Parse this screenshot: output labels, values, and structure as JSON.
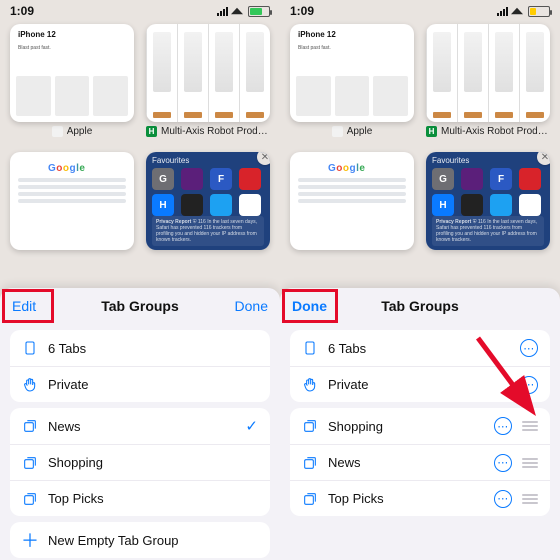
{
  "status": {
    "time": "1:09",
    "battery_left": {
      "pct": 60,
      "color": "#33c759"
    },
    "battery_right": {
      "pct": 28,
      "color": "#ffcc00"
    }
  },
  "tabs": {
    "apple": {
      "title": "iPhone 12",
      "sub": "Blast past fast.",
      "caption": "Apple"
    },
    "robot": {
      "caption": "Multi-Axis Robot Product…",
      "favicon_bg": "#0a8f3c",
      "favicon_label": "H"
    },
    "google": {
      "logo": "Google"
    },
    "favourites": {
      "title": "Favourites",
      "tiles": [
        {
          "bg": "#6e6e73",
          "label": "G"
        },
        {
          "bg": "#5b1f7a",
          "label": ""
        },
        {
          "bg": "#2b59c3",
          "label": "F"
        },
        {
          "bg": "#d8232a",
          "label": ""
        },
        {
          "bg": "#0a7aff",
          "label": "H"
        },
        {
          "bg": "#222",
          "label": ""
        },
        {
          "bg": "#1da1f2",
          "label": ""
        },
        {
          "bg": "#ffffff",
          "label": ""
        }
      ],
      "report_title": "Privacy Report",
      "report_text": "In the last seven days, Safari has prevented 116 trackers from profiling you and hidden your IP address from known trackers.",
      "report_count": "116"
    }
  },
  "sheet": {
    "title": "Tab Groups",
    "edit": "Edit",
    "done": "Done",
    "tabs_count": "6 Tabs",
    "private": "Private",
    "news": "News",
    "shopping": "Shopping",
    "top_picks": "Top Picks",
    "new_group": "New Empty Tab Group"
  },
  "colors": {
    "accent": "#0a7aff",
    "highlight": "#e40b2a"
  }
}
